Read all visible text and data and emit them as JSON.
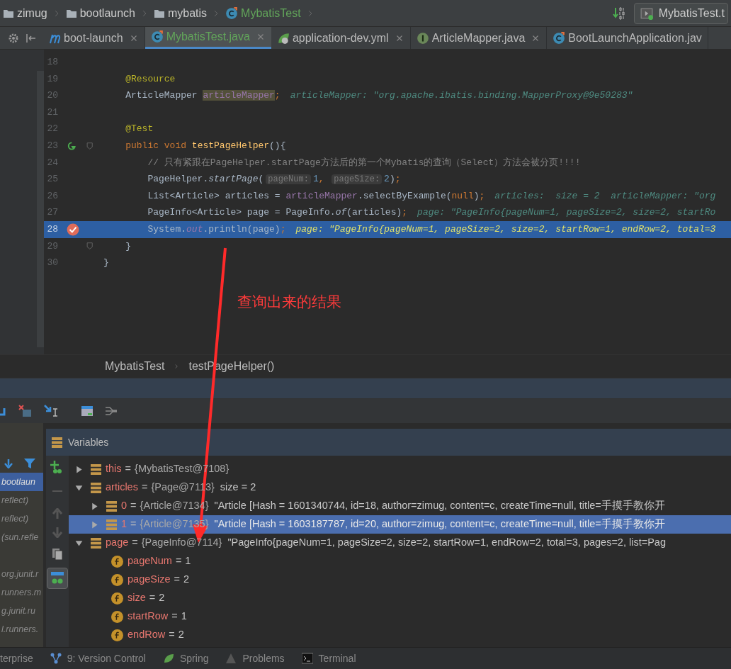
{
  "navigation_bar": {
    "crumbs": [
      {
        "kind": "folder",
        "label": "zimug"
      },
      {
        "kind": "folder",
        "label": "bootlaunch"
      },
      {
        "kind": "folder",
        "label": "mybatis"
      },
      {
        "kind": "class",
        "label": "MybatisTest"
      }
    ],
    "run_configuration": "MybatisTest.t"
  },
  "tabs": [
    {
      "kind": "module",
      "label": "boot-launch",
      "selected": false
    },
    {
      "kind": "class",
      "label": "MybatisTest.java",
      "selected": true
    },
    {
      "kind": "yaml",
      "label": "application-dev.yml",
      "selected": false
    },
    {
      "kind": "interface",
      "label": "ArticleMapper.java",
      "selected": false
    },
    {
      "kind": "class",
      "label": "BootLaunchApplication.jav",
      "selected": false
    }
  ],
  "editor": {
    "lines": [
      {
        "number": "18",
        "run_marker": false,
        "breakpoint": false,
        "fold_marker": false,
        "current": false
      },
      {
        "number": "19",
        "run_marker": false,
        "breakpoint": false,
        "fold_marker": false,
        "current": false,
        "segments": [
          {
            "kind": "annotation",
            "text": "    @Resource"
          }
        ]
      },
      {
        "number": "20",
        "run_marker": false,
        "breakpoint": false,
        "fold_marker": false,
        "current": false,
        "segments": [
          {
            "kind": "plain",
            "text": "    ArticleMapper "
          },
          {
            "kind": "highlighted",
            "text": "articleMapper"
          },
          {
            "kind": "keyword",
            "text": ";"
          }
        ],
        "debug": "articleMapper: \"org.apache.ibatis.binding.MapperProxy@9e50283\""
      },
      {
        "number": "21",
        "run_marker": false,
        "breakpoint": false,
        "fold_marker": false,
        "current": false
      },
      {
        "number": "22",
        "run_marker": false,
        "breakpoint": false,
        "fold_marker": false,
        "current": false,
        "segments": [
          {
            "kind": "annotation",
            "text": "    @Test"
          }
        ]
      },
      {
        "number": "23",
        "run_marker": true,
        "breakpoint": false,
        "fold_marker": true,
        "current": false,
        "segments": [
          {
            "kind": "keyword",
            "text": "    public void "
          },
          {
            "kind": "method",
            "text": "testPageHelper"
          },
          {
            "kind": "plain",
            "text": "(){"
          }
        ]
      },
      {
        "number": "24",
        "run_marker": false,
        "breakpoint": false,
        "fold_marker": false,
        "current": false,
        "segments": [
          {
            "kind": "comment",
            "text": "        // 只有紧跟在PageHelper.startPage方法后的第一个Mybatis的查询（Select）方法会被分页!!!!"
          }
        ]
      },
      {
        "number": "25",
        "run_marker": false,
        "breakpoint": false,
        "fold_marker": false,
        "current": false,
        "segments": [
          {
            "kind": "plain",
            "text": "        PageHelper."
          },
          {
            "kind": "static",
            "text": "startPage"
          },
          {
            "kind": "plain",
            "text": "("
          },
          {
            "kind": "hint",
            "text": "pageNum:"
          },
          {
            "kind": "number",
            "text": "1"
          },
          {
            "kind": "keyword",
            "text": ", "
          },
          {
            "kind": "hint",
            "text": "pageSize:"
          },
          {
            "kind": "number",
            "text": "2"
          },
          {
            "kind": "plain",
            "text": ")"
          },
          {
            "kind": "keyword",
            "text": ";"
          }
        ]
      },
      {
        "number": "26",
        "run_marker": false,
        "breakpoint": false,
        "fold_marker": false,
        "current": false,
        "segments": [
          {
            "kind": "plain",
            "text": "        List<Article> articles = "
          },
          {
            "kind": "member",
            "text": "articleMapper"
          },
          {
            "kind": "plain",
            "text": ".selectByExample("
          },
          {
            "kind": "keyword",
            "text": "null"
          },
          {
            "kind": "plain",
            "text": ")"
          },
          {
            "kind": "keyword",
            "text": ";"
          }
        ],
        "debug": "articles:  size = 2  articleMapper: \"org"
      },
      {
        "number": "27",
        "run_marker": false,
        "breakpoint": false,
        "fold_marker": false,
        "current": false,
        "segments": [
          {
            "kind": "plain",
            "text": "        PageInfo<Article> page = PageInfo."
          },
          {
            "kind": "static",
            "text": "of"
          },
          {
            "kind": "plain",
            "text": "(articles)"
          },
          {
            "kind": "keyword",
            "text": ";"
          }
        ],
        "debug": "page: \"PageInfo{pageNum=1, pageSize=2, size=2, startRo"
      },
      {
        "number": "28",
        "run_marker": false,
        "breakpoint": true,
        "fold_marker": false,
        "current": true,
        "segments": [
          {
            "kind": "plain",
            "text": "        System."
          },
          {
            "kind": "field",
            "text": "out"
          },
          {
            "kind": "plain",
            "text": ".println(page)"
          },
          {
            "kind": "keyword",
            "text": ";"
          }
        ],
        "debug": "page: \"PageInfo{pageNum=1, pageSize=2, size=2, startRow=1, endRow=2, total=3"
      },
      {
        "number": "29",
        "run_marker": false,
        "breakpoint": false,
        "fold_marker": true,
        "current": false,
        "segments": [
          {
            "kind": "plain",
            "text": "    }"
          }
        ]
      },
      {
        "number": "30",
        "run_marker": false,
        "breakpoint": false,
        "fold_marker": false,
        "current": false,
        "segments": [
          {
            "kind": "plain",
            "text": "}"
          }
        ]
      }
    ],
    "breadcrumbs": [
      "MybatisTest",
      "testPageHelper()"
    ]
  },
  "annotation": {
    "text": "查询出来的结果"
  },
  "debugger": {
    "frames": [
      {
        "label": "bootlaun",
        "selected": true
      },
      {
        "label": "reflect)",
        "selected": false
      },
      {
        "label": "reflect)",
        "selected": false
      },
      {
        "label": "(sun.refle",
        "selected": false
      },
      {
        "label": "org.junit.r",
        "selected": false
      },
      {
        "label": "runners.m",
        "selected": false
      },
      {
        "label": "g.junit.ru",
        "selected": false
      },
      {
        "label": "l.runners.",
        "selected": false
      }
    ],
    "variables_title": "Variables",
    "variables": [
      {
        "kind": "object",
        "name": "this",
        "separator": "=",
        "ref": "{MybatisTest@7108}",
        "expanded": false,
        "selected": false
      },
      {
        "kind": "object",
        "name": "articles",
        "separator": "=",
        "ref": "{Page@7113}",
        "value": "size = 2",
        "expanded": true,
        "selected": false,
        "children": [
          {
            "kind": "object",
            "name": "0",
            "separator": "=",
            "ref": "{Article@7134}",
            "value": "\"Article [Hash = 1601340744, id=18, author=zimug, content=c, createTime=null, title=手摸手教你开",
            "expanded": false,
            "selected": false
          },
          {
            "kind": "object",
            "name": "1",
            "separator": "=",
            "ref": "{Article@7135}",
            "value": "\"Article [Hash = 1603187787, id=20, author=zimug, content=c, createTime=null, title=手摸手教你开",
            "expanded": false,
            "selected": true
          }
        ]
      },
      {
        "kind": "object",
        "name": "page",
        "separator": "=",
        "ref": "{PageInfo@7114}",
        "value": "\"PageInfo{pageNum=1, pageSize=2, size=2, startRow=1, endRow=2, total=3, pages=2, list=Pag",
        "expanded": true,
        "selected": false,
        "children": [
          {
            "kind": "field",
            "name": "pageNum",
            "separator": "=",
            "value": "1",
            "selected": false
          },
          {
            "kind": "field",
            "name": "pageSize",
            "separator": "=",
            "value": "2",
            "selected": false
          },
          {
            "kind": "field",
            "name": "size",
            "separator": "=",
            "value": "2",
            "selected": false
          },
          {
            "kind": "field",
            "name": "startRow",
            "separator": "=",
            "value": "1",
            "selected": false
          },
          {
            "kind": "field",
            "name": "endRow",
            "separator": "=",
            "value": "2",
            "selected": false
          }
        ]
      }
    ]
  },
  "status_bar": [
    {
      "kind": "none",
      "label": "terprise"
    },
    {
      "kind": "vcs",
      "label": "9: Version Control"
    },
    {
      "kind": "spring",
      "label": "Spring"
    },
    {
      "kind": "warning",
      "label": "Problems"
    },
    {
      "kind": "terminal",
      "label": "Terminal"
    }
  ]
}
